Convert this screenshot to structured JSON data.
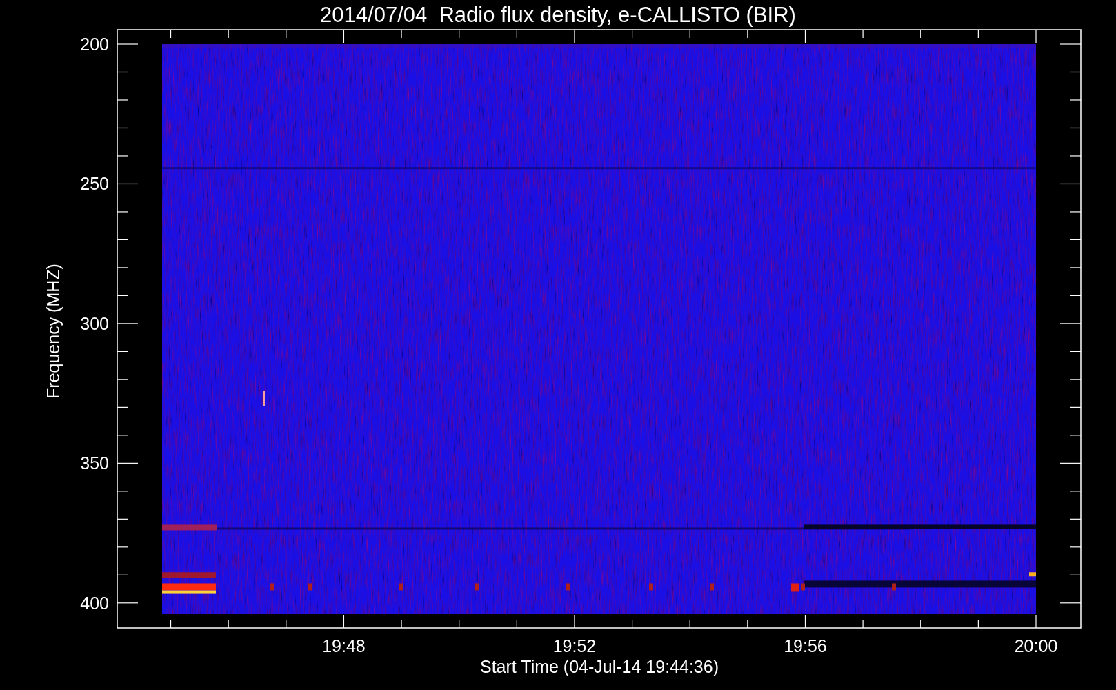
{
  "title": "2014/07/04  Radio flux density, e-CALLISTO (BIR)",
  "y_axis": {
    "label": "Frequency (MHZ)",
    "ticks": [
      "200",
      "250",
      "300",
      "350",
      "400"
    ]
  },
  "x_axis": {
    "label": "Start Time (04-Jul-14 19:44:36)",
    "ticks": [
      "19:48",
      "19:52",
      "19:56",
      "20:00"
    ]
  }
}
